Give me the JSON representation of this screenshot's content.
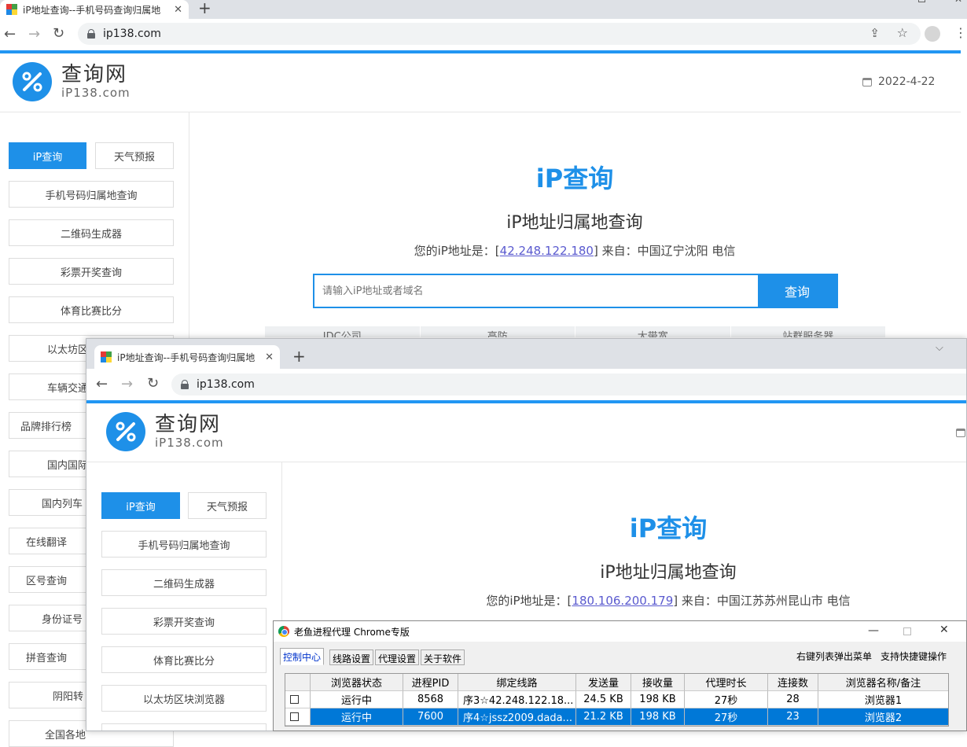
{
  "browser1": {
    "tab_title": "iP地址查询--手机号码查询归属地",
    "url": "ip138.com"
  },
  "browser2": {
    "tab_title": "iP地址查询--手机号码查询归属地",
    "url": "ip138.com"
  },
  "site": {
    "logo_name": "查询网",
    "logo_domain": "iP138.com",
    "date": "2022-4-22",
    "sidebar1": [
      "iP查询",
      "天气预报",
      "手机号码归属地查询",
      "二维码生成器",
      "彩票开奖查询",
      "体育比赛比分",
      "以太坊区",
      "车辆交通",
      "品牌排行榜",
      "国内国际",
      "国内列车",
      "在线翻译",
      "区号查询",
      "身份证号",
      "拼音查询",
      "阴阳转",
      "全国各地"
    ],
    "sidebar2": [
      "iP查询",
      "天气预报",
      "手机号码归属地查询",
      "二维码生成器",
      "彩票开奖查询",
      "体育比赛比分",
      "以太坊区块浏览器"
    ],
    "title": "iP查询",
    "subtitle": "iP地址归属地查询",
    "ip_prefix": "您的iP地址是：[",
    "ip_suffix_bracket": "]",
    "ip_from_label": " 来自：",
    "ip1": "42.248.122.180",
    "loc1": "中国辽宁沈阳 电信",
    "ip2": "180.106.200.179",
    "loc2": "中国江苏苏州昆山市 电信",
    "search_placeholder": "请输入iP地址或者域名",
    "search_button": "查询",
    "categories": [
      "IDC公司",
      "高防",
      "大带宽",
      "站群服务器"
    ]
  },
  "dialog": {
    "title": "老鱼进程代理 Chrome专版",
    "tabs": [
      "控制中心",
      "线路设置",
      "代理设置",
      "关于软件"
    ],
    "hint_menu": "右键列表弹出菜单",
    "hint_shortcut": "支持快捷键操作",
    "columns": [
      "浏览器状态",
      "进程PID",
      "绑定线路",
      "发送量",
      "接收量",
      "代理时长",
      "连接数",
      "浏览器名称/备注"
    ],
    "rows": [
      [
        "运行中",
        "8568",
        "序3☆42.248.122.18...",
        "24.5 KB",
        "198 KB",
        "27秒",
        "28",
        "浏览器1"
      ],
      [
        "运行中",
        "7600",
        "序4☆jssz2009.dada...",
        "21.2 KB",
        "198 KB",
        "27秒",
        "23",
        "浏览器2"
      ]
    ]
  },
  "colors": {
    "accent": "#1e90e8",
    "selection": "#0078d7"
  }
}
